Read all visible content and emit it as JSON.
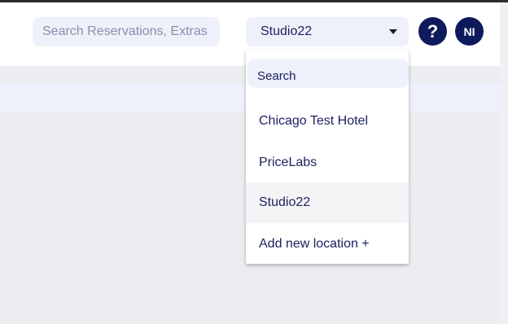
{
  "header": {
    "search": {
      "placeholder": "Search Reservations, Extras ..",
      "icon": "none"
    },
    "location_select": {
      "value": "Studio22",
      "icon": "caret-down-icon"
    },
    "help_button": {
      "label": "?",
      "color": "#0f1a5c"
    },
    "avatar": {
      "initials": "NI",
      "color": "#0f1a5c"
    }
  },
  "location_dropdown": {
    "search_placeholder": "Search",
    "items": [
      {
        "label": "Chicago Test Hotel"
      },
      {
        "label": "PriceLabs"
      },
      {
        "label": "Studio22",
        "selected": true
      },
      {
        "label": "Add new location +"
      }
    ]
  },
  "colors": {
    "text": "#1c2261",
    "accent": "#0f1a5c",
    "field_bg": "#eef0fa",
    "page_bg": "#ecedf1"
  }
}
